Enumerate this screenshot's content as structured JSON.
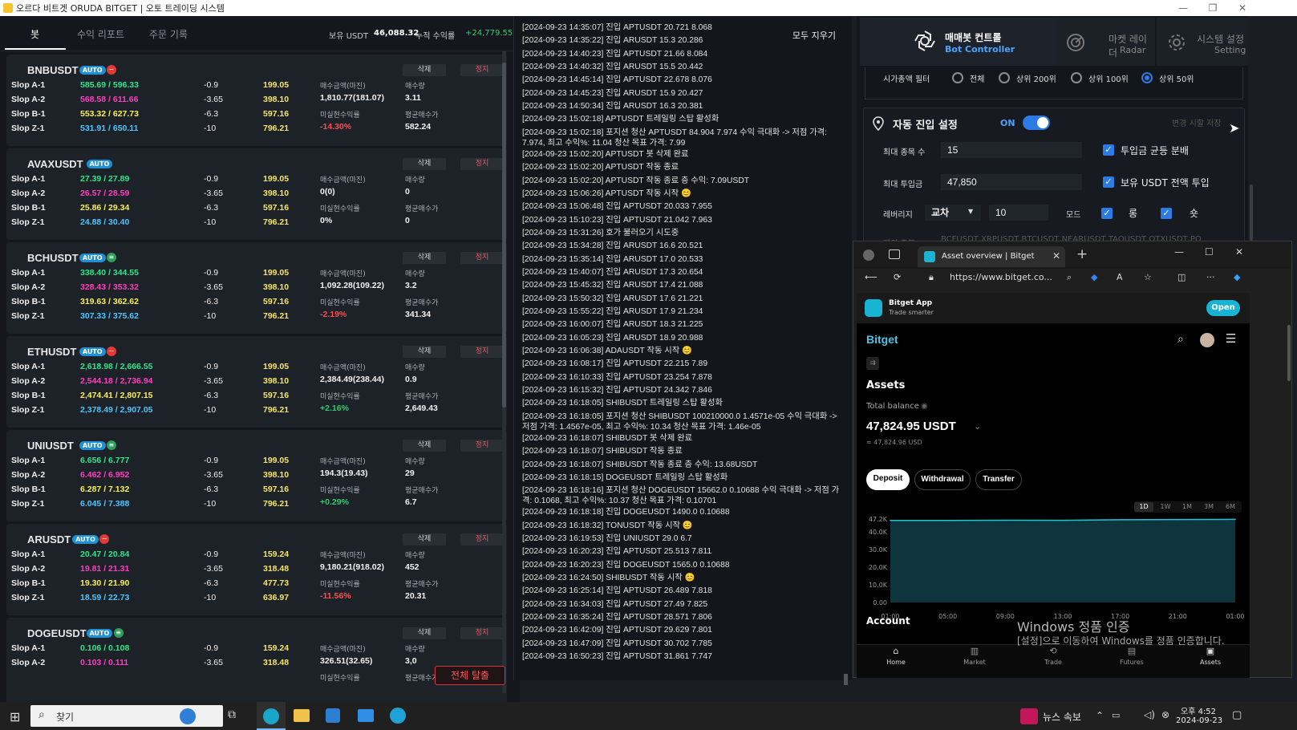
{
  "window": {
    "title": "오르다 비트겟 ORUDA BITGET | 오토 트레이딩 시스템"
  },
  "left": {
    "tabs": [
      "봇",
      "수익 리포트",
      "주문 기록"
    ],
    "holdings_label": "보유 USDT",
    "holdings_value": "46,088.32",
    "cum_label": "누적 수익률",
    "cum_value": "+24,779.55%",
    "delete_label": "삭제",
    "stop_label": "정지",
    "lbl_buy_margin": "매수금액(마진)",
    "lbl_buy_qty": "매수량",
    "lbl_unreal": "미실현수익률",
    "lbl_avg": "평균매수가",
    "exit_all": "전체 탈출",
    "bots": [
      {
        "symbol": "BNBUSDT",
        "badge": "AUTO",
        "dot": "red",
        "rows": [
          [
            "Slop A-1",
            "585.69 / 596.33",
            "-0.9",
            "199.05"
          ],
          [
            "Slop A-2",
            "568.58 / 611.66",
            "-3.65",
            "398.10"
          ],
          [
            "Slop B-1",
            "553.32 / 627.73",
            "-6.3",
            "597.16"
          ],
          [
            "Slop Z-1",
            "531.91 / 650.11",
            "-10",
            "796.21"
          ]
        ],
        "margin": "1,810.77(181.07)",
        "qty": "3.11",
        "unreal": "-14.30%",
        "avg": "582.24"
      },
      {
        "symbol": "AVAXUSDT",
        "badge": "AUTO",
        "dot": "",
        "rows": [
          [
            "Slop A-1",
            "27.39 / 27.89",
            "-0.9",
            "199.05"
          ],
          [
            "Slop A-2",
            "26.57 / 28.59",
            "-3.65",
            "398.10"
          ],
          [
            "Slop B-1",
            "25.86 / 29.34",
            "-6.3",
            "597.16"
          ],
          [
            "Slop Z-1",
            "24.88 / 30.40",
            "-10",
            "796.21"
          ]
        ],
        "margin": "0(0)",
        "qty": "0",
        "unreal": "0%",
        "avg": "0"
      },
      {
        "symbol": "BCHUSDT",
        "badge": "AUTO",
        "dot": "green",
        "rows": [
          [
            "Slop A-1",
            "338.40 / 344.55",
            "-0.9",
            "199.05"
          ],
          [
            "Slop A-2",
            "328.43 / 353.32",
            "-3.65",
            "398.10"
          ],
          [
            "Slop B-1",
            "319.63 / 362.62",
            "-6.3",
            "597.16"
          ],
          [
            "Slop Z-1",
            "307.33 / 375.62",
            "-10",
            "796.21"
          ]
        ],
        "margin": "1,092.28(109.22)",
        "qty": "3.2",
        "unreal": "-2.19%",
        "avg": "341.34"
      },
      {
        "symbol": "ETHUSDT",
        "badge": "AUTO",
        "dot": "red",
        "rows": [
          [
            "Slop A-1",
            "2,618.98 / 2,666.55",
            "-0.9",
            "199.05"
          ],
          [
            "Slop A-2",
            "2,544.18 / 2,736.94",
            "-3.65",
            "398.10"
          ],
          [
            "Slop B-1",
            "2,474.41 / 2,807.15",
            "-6.3",
            "597.16"
          ],
          [
            "Slop Z-1",
            "2,378.49 / 2,907.05",
            "-10",
            "796.21"
          ]
        ],
        "margin": "2,384.49(238.44)",
        "qty": "0.9",
        "unreal": "+2.16%",
        "avg": "2,649.43"
      },
      {
        "symbol": "UNIUSDT",
        "badge": "AUTO",
        "dot": "green",
        "rows": [
          [
            "Slop A-1",
            "6.656 / 6.777",
            "-0.9",
            "199.05"
          ],
          [
            "Slop A-2",
            "6.462 / 6.952",
            "-3.65",
            "398.10"
          ],
          [
            "Slop B-1",
            "6.287 / 7.132",
            "-6.3",
            "597.16"
          ],
          [
            "Slop Z-1",
            "6.045 / 7.388",
            "-10",
            "796.21"
          ]
        ],
        "margin": "194.3(19.43)",
        "qty": "29",
        "unreal": "+0.29%",
        "avg": "6.7"
      },
      {
        "symbol": "ARUSDT",
        "badge": "AUTO",
        "dot": "red",
        "rows": [
          [
            "Slop A-1",
            "20.47 / 20.84",
            "-0.9",
            "159.24"
          ],
          [
            "Slop A-2",
            "19.81 / 21.31",
            "-3.65",
            "318.48"
          ],
          [
            "Slop B-1",
            "19.30 / 21.90",
            "-6.3",
            "477.73"
          ],
          [
            "Slop Z-1",
            "18.59 / 22.73",
            "-10",
            "636.97"
          ]
        ],
        "margin": "9,180.21(918.02)",
        "qty": "452",
        "unreal": "-11.56%",
        "avg": "20.31"
      },
      {
        "symbol": "DOGEUSDT",
        "badge": "AUTO",
        "dot": "green",
        "rows": [
          [
            "Slop A-1",
            "0.106 / 0.108",
            "-0.9",
            "159.24"
          ],
          [
            "Slop A-2",
            "0.103 / 0.111",
            "-3.65",
            "318.48"
          ]
        ],
        "margin": "326.51(32.65)",
        "qty": "3,0",
        "unreal": "",
        "avg": ""
      }
    ]
  },
  "log": {
    "clear_label": "모두 지우기",
    "lines": [
      "[2024-09-23 14:35:07] 진입 APTUSDT 20.721 8.068",
      "[2024-09-23 14:35:22] 진입 ARUSDT 15.3 20.286",
      "[2024-09-23 14:40:23] 진입 APTUSDT 21.66 8.084",
      "[2024-09-23 14:40:32] 진입 ARUSDT 15.5 20.442",
      "[2024-09-23 14:45:14] 진입 APTUSDT 22.678 8.076",
      "[2024-09-23 14:45:23] 진입 ARUSDT 15.9 20.427",
      "[2024-09-23 14:50:34] 진입 ARUSDT 16.3 20.381",
      "[2024-09-23 15:02:18] APTUSDT 트레일링 스탑 활성화",
      "[2024-09-23 15:02:18] 포지션 청산 APTUSDT 84.904 7.974 수익 극대화 -> 저점 가격: 7.974, 최고 수익%: 11.04 청산 목표 가격: 7.99",
      "[2024-09-23 15:02:20] APTUSDT 봇 삭제 완료",
      "[2024-09-23 15:02:20] APTUSDT 작동 종료",
      "[2024-09-23 15:02:20] APTUSDT 작동 종료 층 수익: 7.09USDT",
      "[2024-09-23 15:06:26] APTUSDT 작동 시작 😊",
      "[2024-09-23 15:06:48] 진입 APTUSDT 20.033 7.955",
      "[2024-09-23 15:10:23] 진입 APTUSDT 21.042 7.963",
      "[2024-09-23 15:31:26] 호가 불러오기 시도중",
      "[2024-09-23 15:34:28] 진입 ARUSDT 16.6 20.521",
      "[2024-09-23 15:35:14] 진입 ARUSDT 17.0 20.533",
      "[2024-09-23 15:40:07] 진입 ARUSDT 17.3 20.654",
      "[2024-09-23 15:45:32] 진입 ARUSDT 17.4 21.088",
      "[2024-09-23 15:50:32] 진입 ARUSDT 17.6 21.221",
      "[2024-09-23 15:55:22] 진입 ARUSDT 17.9 21.234",
      "[2024-09-23 16:00:07] 진입 ARUSDT 18.3 21.225",
      "[2024-09-23 16:05:23] 진입 ARUSDT 18.9 20.988",
      "[2024-09-23 16:06:38] ADAUSDT 작동 시작 😊",
      "[2024-09-23 16:08:17] 진입 APTUSDT 22.215 7.89",
      "[2024-09-23 16:10:33] 진입 APTUSDT 23.254 7.878",
      "[2024-09-23 16:15:32] 진입 APTUSDT 24.342 7.846",
      "[2024-09-23 16:18:05] SHIBUSDT 트레일링 스탑 활성화",
      "[2024-09-23 16:18:05] 포지션 청산 SHIBUSDT 100210000.0 1.4571e-05 수익 극대화 -> 저점 가격: 1.4567e-05, 최고 수익%: 10.34 청산 목표 가격: 1.46e-05",
      "[2024-09-23 16:18:07] SHIBUSDT 봇 삭제 완료",
      "[2024-09-23 16:18:07] SHIBUSDT 작동 종료",
      "[2024-09-23 16:18:07] SHIBUSDT 작동 종료 층 수익: 13.68USDT",
      "[2024-09-23 16:18:15] DOGEUSDT 트레일링 스탑 활성화",
      "[2024-09-23 16:18:16] 포지션 청산 DOGEUSDT 15662.0 0.10688 수익 극대화 -> 저점 가격: 0.1068, 최고 수익%: 10.37 청산 목표 가격: 0.10701",
      "[2024-09-23 16:18:18] 진입 DOGEUSDT 1490.0 0.10688",
      "[2024-09-23 16:18:32] TONUSDT 작동 시작 😊",
      "[2024-09-23 16:19:53] 진입 UNIUSDT 29.0 6.7",
      "[2024-09-23 16:20:23] 진입 APTUSDT 25.513 7.811",
      "[2024-09-23 16:20:23] 진입 DOGEUSDT 1565.0 0.10688",
      "[2024-09-23 16:24:50] SHIBUSDT 작동 시작 😊",
      "[2024-09-23 16:25:14] 진입 APTUSDT 26.489 7.818",
      "[2024-09-23 16:34:03] 진입 APTUSDT 27.49 7.825",
      "[2024-09-23 16:35:24] 진입 APTUSDT 28.571 7.806",
      "[2024-09-23 16:42:09] 진입 APTUSDT 29.629 7.801",
      "[2024-09-23 16:47:09] 진입 APTUSDT 30.702 7.785",
      "[2024-09-23 16:50:23] 진입 APTUSDT 31.861 7.747"
    ]
  },
  "controller": {
    "tab1_title": "매매봇 컨트롤",
    "tab1_sub": "Bot Controller",
    "tab2_title": "마켓 레이더",
    "tab2_sub": "Radar",
    "tab3_title": "시스템 설정",
    "tab3_sub": "Setting",
    "cap_filter_label": "시가총액 필터",
    "cap_options": [
      "전체",
      "상위 200위",
      "상위 100위",
      "상위 50위"
    ],
    "cap_selected": "상위 50위",
    "auto_entry_title": "자동 진입 설정",
    "auto_entry_state": "ON",
    "change_hint": "변경 시할 저장",
    "max_symbols_label": "최대 종목 수",
    "max_symbols_value": "15",
    "even_split_label": "투입금 균등 분배",
    "max_invest_label": "최대 투입금",
    "max_invest_value": "47,850",
    "all_usdt_label": "보유 USDT 전액 투입",
    "leverage_label": "레버리지",
    "leverage_mode": "교차",
    "leverage_value": "10",
    "mode_label": "모드",
    "long_label": "롱",
    "short_label": "숏",
    "hidden_row": "제외 종목",
    "hidden_row_value": "BCFUSDT,XRPUSDT,BTCUSDT,NEARUSDT,TAOUSDT,OTXUSDT,PO"
  },
  "browser": {
    "tab_title": "Asset overview | Bitget",
    "url": "https://www.bitget.co...",
    "app_name": "Bitget App",
    "app_tagline": "Trade smarter",
    "open_label": "Open",
    "brand": "Bitget",
    "assets_title": "Assets",
    "total_balance_label": "Total balance",
    "total_balance": "47,824.95 USDT",
    "total_balance_usd": "≈ 47,824.96 USD",
    "deposit": "Deposit",
    "withdrawal": "Withdrawal",
    "transfer": "Transfer",
    "ranges": [
      "1D",
      "1W",
      "1M",
      "3M",
      "6M"
    ],
    "selected_range": "1D",
    "account_title": "Account",
    "nav": [
      "Home",
      "Market",
      "Trade",
      "Futures",
      "Assets"
    ]
  },
  "chart_data": {
    "type": "area",
    "x": [
      "01:00",
      "05:00",
      "09:00",
      "13:00",
      "17:00",
      "21:00",
      "01:00"
    ],
    "y_ticks": [
      "47.2K",
      "40.0K",
      "30.0K",
      "20.0K",
      "10.0K",
      "0.00"
    ],
    "values": [
      47200,
      47150,
      47300,
      47250,
      47600,
      47700,
      47824
    ]
  },
  "watermark": {
    "line1": "Windows 정품 인증",
    "line2": "[설정]으로 이동하여 Windows를 정품 인증합니다."
  },
  "taskbar": {
    "search": "찾기",
    "news": "뉴스 속보",
    "time": "오후 4:52",
    "date": "2024-09-23"
  }
}
